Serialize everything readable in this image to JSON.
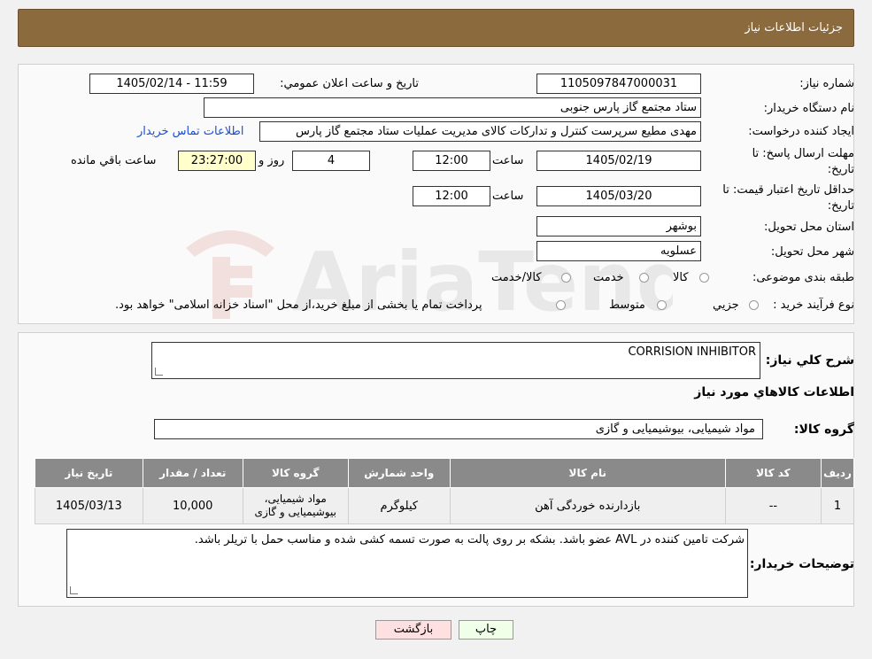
{
  "header": {
    "title": "جزئیات اطلاعات نیاز"
  },
  "form": {
    "need_number_label": "شماره نیاز:",
    "need_number": "1105097847000031",
    "announce_label": "تاريخ و ساعت اعلان عمومي:",
    "announce_value": "1405/02/14 - 11:59",
    "buyer_org_label": "نام دستگاه خريدار:",
    "buyer_org": "ستاد مجتمع گاز پارس جنوبی",
    "creator_label": "ايجاد کننده درخواست:",
    "creator": "مهدی مطیع سرپرست کنترل و تدارکات کالای مدیریت عملیات ستاد مجتمع گاز پارس",
    "contact_link": "اطلاعات تماس خریدار",
    "deadline_label": "مهلت ارسال پاسخ: تا تاریخ:",
    "deadline_date": "1405/02/19",
    "time_label": "ساعت",
    "deadline_time": "12:00",
    "days": "4",
    "days_label": "روز و",
    "remaining": "23:27:00",
    "remaining_label": "ساعت باقي مانده",
    "validity_label": "حداقل تاريخ اعتبار قيمت: تا تاریخ:",
    "validity_date": "1405/03/20",
    "validity_time": "12:00",
    "province_label": "استان محل تحويل:",
    "province": "بوشهر",
    "city_label": "شهر محل تحويل:",
    "city": "عسلویه",
    "category_label": "طبقه بندی موضوعی:",
    "category_options": [
      "کالا",
      "خدمت",
      "کالا/خدمت"
    ],
    "process_label": "نوع فرآيند خريد :",
    "process_options": [
      "جزيي",
      "متوسط"
    ],
    "process_note": "پرداخت تمام یا بخشی از مبلغ خرید،از محل \"اسناد خزانه اسلامی\" خواهد بود."
  },
  "details": {
    "summary_label": "شرح كلي نياز:",
    "summary": "CORRISION INHIBITOR",
    "goods_info_title": "اطلاعات کالاهاي مورد نياز",
    "group_label": "گروه کالا:",
    "group_value": "مواد شیمیایی، بیوشیمیایی و  گازی",
    "table_headers": [
      "رديف",
      "کد کالا",
      "نام کالا",
      "واحد شمارش",
      "گروه کالا",
      "تعداد / مقدار",
      "تاريخ نياز"
    ],
    "rows": [
      {
        "index": "1",
        "code": "--",
        "name": "بازدارنده خوردگی آهن",
        "unit": "کیلوگرم",
        "group": "مواد شیمیایی، بیوشیمیایی و گازی",
        "qty": "10,000",
        "date": "1405/03/13"
      }
    ],
    "buyer_notes_label": "توضيحات خريدار:",
    "buyer_notes": "شرکت تامین کننده در AVL عضو باشد. بشکه بر روی پالت به صورت تسمه کشی شده و مناسب حمل با تریلر باشد."
  },
  "buttons": {
    "print": "چاپ",
    "back": "بازگشت"
  },
  "watermark": {
    "text": "AriaTender.neT"
  }
}
